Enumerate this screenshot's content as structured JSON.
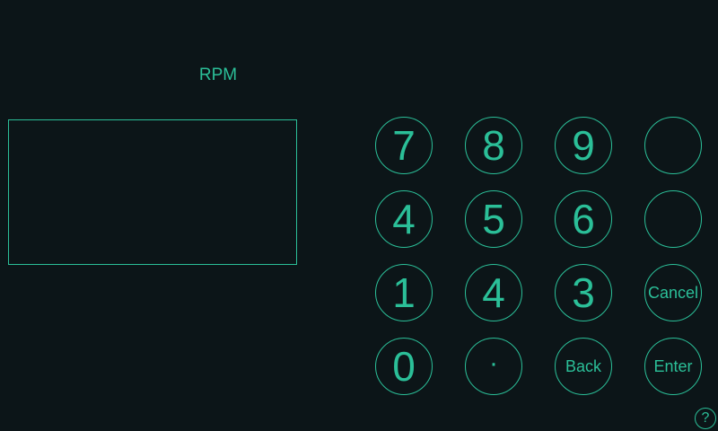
{
  "display": {
    "unit_label": "RPM",
    "value": ""
  },
  "keypad": {
    "row1": [
      "7",
      "8",
      "9",
      ""
    ],
    "row2": [
      "4",
      "5",
      "6",
      ""
    ],
    "row3": [
      "1",
      "4",
      "3",
      "Cancel"
    ],
    "row4": [
      "0",
      "·",
      "Back",
      "Enter"
    ]
  },
  "help": {
    "label": "?"
  },
  "colors": {
    "background": "#0c1518",
    "accent": "#2bbf98"
  }
}
